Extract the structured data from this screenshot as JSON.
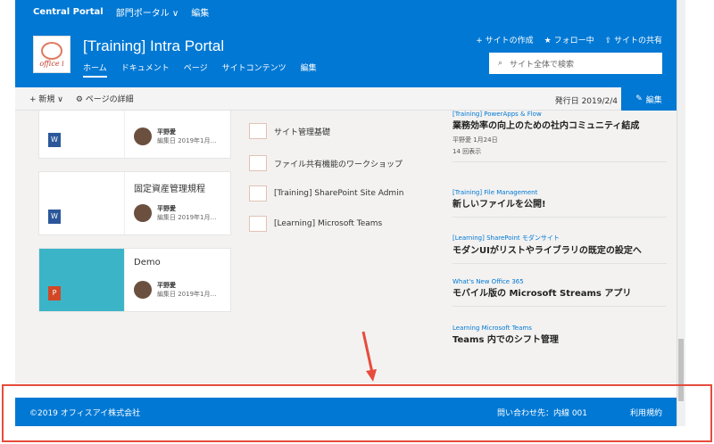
{
  "suitebar": {
    "brand": "Central Portal",
    "nav": "部門ポータル ∨",
    "edit": "編集"
  },
  "site": {
    "title": "[Training] Intra Portal",
    "logo_text": "office i"
  },
  "topnav": [
    "ホーム",
    "ドキュメント",
    "ページ",
    "サイトコンテンツ",
    "編集"
  ],
  "header_actions": [
    "+ サイトの作成",
    "★ フォロー中",
    "⇪ サイトの共有"
  ],
  "search": {
    "placeholder": "サイト全体で検索"
  },
  "cmdbar": {
    "new": "+ 新規 ∨",
    "details": "⚙ ページの詳細",
    "published": "発行日 2019/2/4",
    "edit": "編集"
  },
  "cards": [
    {
      "title": "",
      "author": "平野愛",
      "date": "編集日 2019年1月…"
    },
    {
      "title": "固定資産管理規程",
      "author": "平野愛",
      "date": "編集日 2019年1月…"
    },
    {
      "title": "Demo",
      "author": "平野愛",
      "date": "編集日 2019年1月…"
    }
  ],
  "mid_items": [
    "サイト管理基礎",
    "ファイル共有機能のワークショップ",
    "[Training] SharePoint Site Admin",
    "[Learning] Microsoft Teams"
  ],
  "news": [
    {
      "cat": "[Training] PowerApps & Flow",
      "head": "業務効率の向上のための社内コミュニティ結成",
      "meta": "平野愛 1月24日",
      "views": "14 回表示"
    },
    {
      "cat": "[Training] File Management",
      "head": "新しいファイルを公開!",
      "meta": "",
      "views": ""
    },
    {
      "cat": "[Learning] SharePoint モダンサイト",
      "head": "モダンUIがリストやライブラリの既定の設定へ",
      "meta": "",
      "views": ""
    },
    {
      "cat": "What's New Office 365",
      "head": "モバイル版の Microsoft Streams アプリ",
      "meta": "",
      "views": ""
    },
    {
      "cat": "Learning Microsoft Teams",
      "head": "Teams 内でのシフト管理",
      "meta": "",
      "views": ""
    }
  ],
  "footer": {
    "copy": "©2019 オフィスアイ株式会社",
    "contact": "問い合わせ先：内線 001",
    "terms": "利用規約"
  },
  "colors": {
    "accent": "#0078d4",
    "highlight": "#e74c3c"
  }
}
